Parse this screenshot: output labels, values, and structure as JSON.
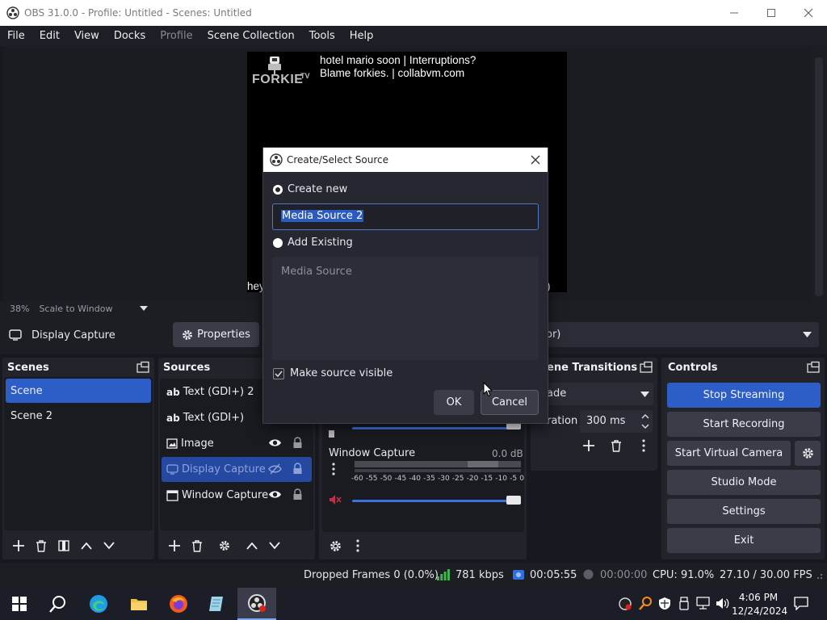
{
  "window": {
    "title": "OBS 31.0.0 - Profile: Untitled - Scenes: Untitled",
    "menu": [
      "File",
      "Edit",
      "View",
      "Docks",
      "Profile",
      "Scene Collection",
      "Tools",
      "Help"
    ]
  },
  "preview": {
    "logo_text": "FORKIE",
    "logo_sup": "TV",
    "ticker_line1": "hotel mario soon | Interruptions?",
    "ticker_line2": "Blame forkies. | collabvm.com",
    "bottom_left": "hey",
    "bottom_right": ")",
    "zoom": "38%",
    "scale_mode": "Scale to Window"
  },
  "source_toolbar": {
    "selected_source": "Display Capture",
    "properties": "Properties",
    "dropdown_value": "or)"
  },
  "docks": {
    "scenes": {
      "title": "Scenes",
      "items": [
        "Scene",
        "Scene 2"
      ]
    },
    "sources": {
      "title": "Sources",
      "items": [
        {
          "label": "Text (GDI+) 2",
          "icon": "text-icon"
        },
        {
          "label": "Text (GDI+)",
          "icon": "text-icon"
        },
        {
          "label": "Image",
          "icon": "image-icon"
        },
        {
          "label": "Display Capture",
          "icon": "monitor-icon"
        },
        {
          "label": "Window Capture",
          "icon": "window-icon"
        }
      ]
    },
    "mixer": {
      "track_label": "Window Capture",
      "track_db": "0.0 dB",
      "scale": [
        "-60",
        "-55",
        "-50",
        "-45",
        "-40",
        "-35",
        "-30",
        "-25",
        "-20",
        "-15",
        "-10",
        "-5",
        "0"
      ]
    },
    "transitions": {
      "title": "ene Transitions",
      "transition_value": "ade",
      "duration_label": "ration",
      "duration_value": "300 ms"
    },
    "controls": {
      "title": "Controls",
      "stop_streaming": "Stop Streaming",
      "start_recording": "Start Recording",
      "start_virtual_camera": "Start Virtual Camera",
      "studio_mode": "Studio Mode",
      "settings": "Settings",
      "exit": "Exit"
    }
  },
  "statusbar": {
    "dropped_frames": "Dropped Frames 0 (0.0%)",
    "kbps": "781 kbps",
    "stream_time": "00:05:55",
    "rec_time": "00:00:00",
    "cpu": "CPU: 91.0%",
    "fps": "27.10 / 30.00 FPS"
  },
  "dialog": {
    "title": "Create/Select Source",
    "create_new": "Create new",
    "name_value": "Media Source 2",
    "add_existing": "Add Existing",
    "existing_list_item": "Media Source",
    "make_visible": "Make source visible",
    "ok": "OK",
    "cancel": "Cancel"
  },
  "taskbar": {
    "time": "4:06 PM",
    "date": "12/24/2024"
  },
  "colors": {
    "accent": "#2d5ec8",
    "background": "#181920",
    "dock": "#22232b"
  }
}
